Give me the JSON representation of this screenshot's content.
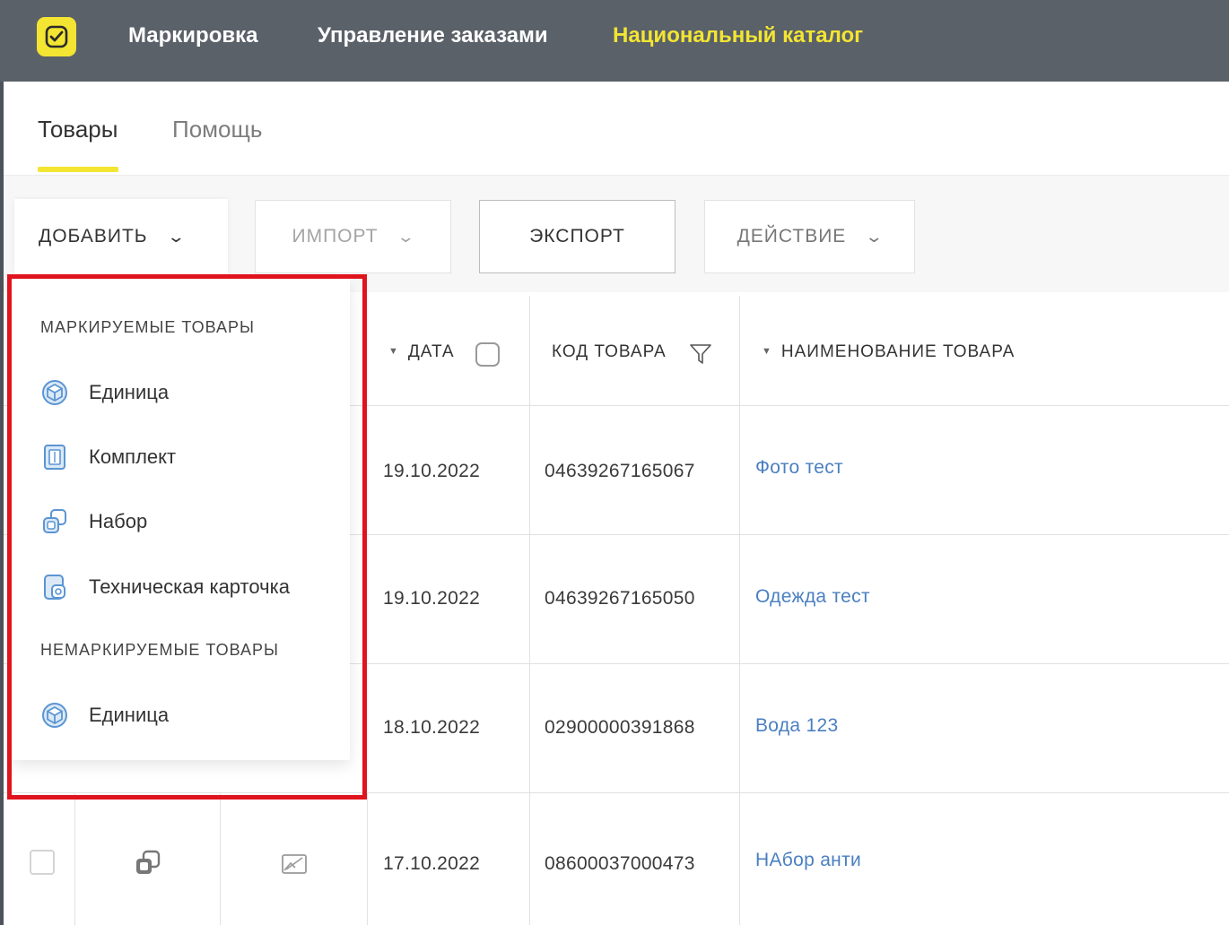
{
  "header": {
    "logo_icon": "check-smile-icon",
    "nav": [
      {
        "label": "Маркировка"
      },
      {
        "label": "Управление заказами"
      },
      {
        "label": "Национальный каталог"
      }
    ],
    "active_color": "#f3e532",
    "bar_color": "#5a6169"
  },
  "tabs": [
    {
      "label": "Товары",
      "active": true
    },
    {
      "label": "Помощь",
      "active": false
    }
  ],
  "toolbar": {
    "add_label": "ДОБАВИТЬ",
    "import_label": "ИМПОРТ",
    "export_label": "ЭКСПОРТ",
    "action_label": "ДЕЙСТВИЕ"
  },
  "table": {
    "headers": {
      "date": "ДАТА",
      "code": "КОД ТОВАРА",
      "name": "НАИМЕНОВАНИЕ ТОВАРА"
    },
    "rows": [
      {
        "date": "19.10.2022",
        "code": "04639267165067",
        "name": "Фото тест"
      },
      {
        "date": "19.10.2022",
        "code": "04639267165050",
        "name": "Одежда тест"
      },
      {
        "date": "18.10.2022",
        "code": "02900000391868",
        "name": "Вода 123"
      },
      {
        "date": "17.10.2022",
        "code": "08600037000473",
        "name": "НАбор анти"
      }
    ]
  },
  "menu": {
    "group1": "МАРКИРУЕМЫЕ ТОВАРЫ",
    "group1_items": [
      {
        "label": "Единица",
        "icon": "cube-icon"
      },
      {
        "label": "Комплект",
        "icon": "box-icon"
      },
      {
        "label": "Набор",
        "icon": "set-icon"
      },
      {
        "label": "Техническая карточка",
        "icon": "tech-card-icon"
      }
    ],
    "group2": "НЕМАРКИРУЕМЫЕ ТОВАРЫ",
    "group2_items": [
      {
        "label": "Единица",
        "icon": "cube-icon"
      }
    ],
    "highlight_color": "#e0141e"
  }
}
